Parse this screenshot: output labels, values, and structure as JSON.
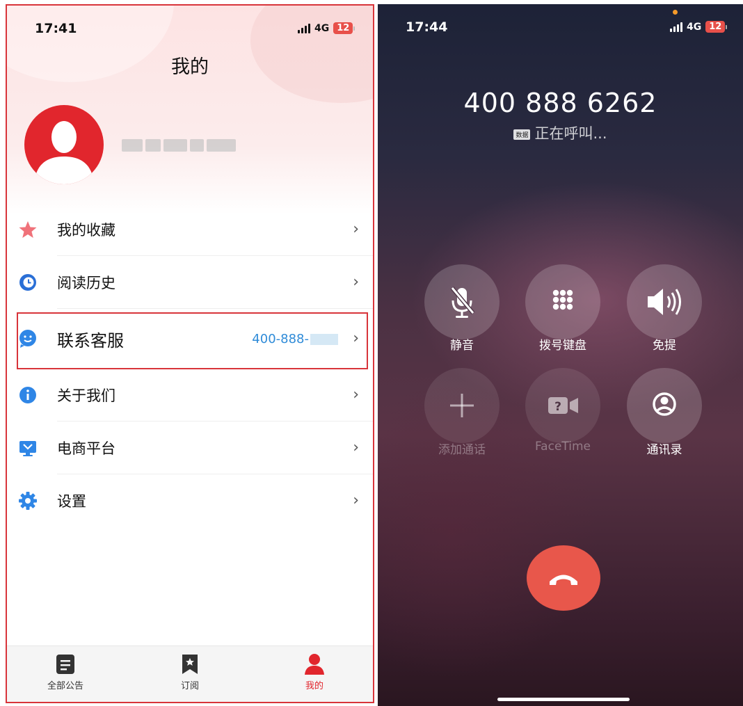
{
  "left": {
    "status_bar": {
      "time": "17:41",
      "network": "4G",
      "battery": "12"
    },
    "page_title": "我的",
    "menu": [
      {
        "label": "我的收藏",
        "icon": "star-icon",
        "value": ""
      },
      {
        "label": "阅读历史",
        "icon": "history-clock-icon",
        "value": ""
      },
      {
        "label": "联系客服",
        "icon": "customer-service-icon",
        "value": "400-888-"
      },
      {
        "label": "关于我们",
        "icon": "info-icon",
        "value": ""
      },
      {
        "label": "电商平台",
        "icon": "store-screen-icon",
        "value": ""
      },
      {
        "label": "设置",
        "icon": "gear-icon",
        "value": ""
      }
    ],
    "tabs": [
      {
        "label": "全部公告",
        "icon": "announcement-list-icon",
        "active": false
      },
      {
        "label": "订阅",
        "icon": "bookmark-star-icon",
        "active": false
      },
      {
        "label": "我的",
        "icon": "person-icon",
        "active": true
      }
    ],
    "colors": {
      "accent": "#e1262d",
      "link": "#2f8bd8",
      "highlight_border": "#d8343a"
    }
  },
  "right": {
    "status_bar": {
      "time": "17:44",
      "network": "4G",
      "battery": "12"
    },
    "call": {
      "number": "400 888 6262",
      "data_tag": "数据",
      "status": "正在呼叫..."
    },
    "buttons": [
      {
        "label": "静音",
        "icon": "mute-mic-icon",
        "enabled": true
      },
      {
        "label": "拨号键盘",
        "icon": "keypad-icon",
        "enabled": true
      },
      {
        "label": "免提",
        "icon": "speaker-icon",
        "enabled": true
      },
      {
        "label": "添加通话",
        "icon": "plus-icon",
        "enabled": false
      },
      {
        "label": "FaceTime",
        "icon": "facetime-icon",
        "enabled": false
      },
      {
        "label": "通讯录",
        "icon": "contacts-icon",
        "enabled": true
      }
    ],
    "end_call_icon": "end-call-icon",
    "colors": {
      "end_call": "#e8574b"
    }
  }
}
